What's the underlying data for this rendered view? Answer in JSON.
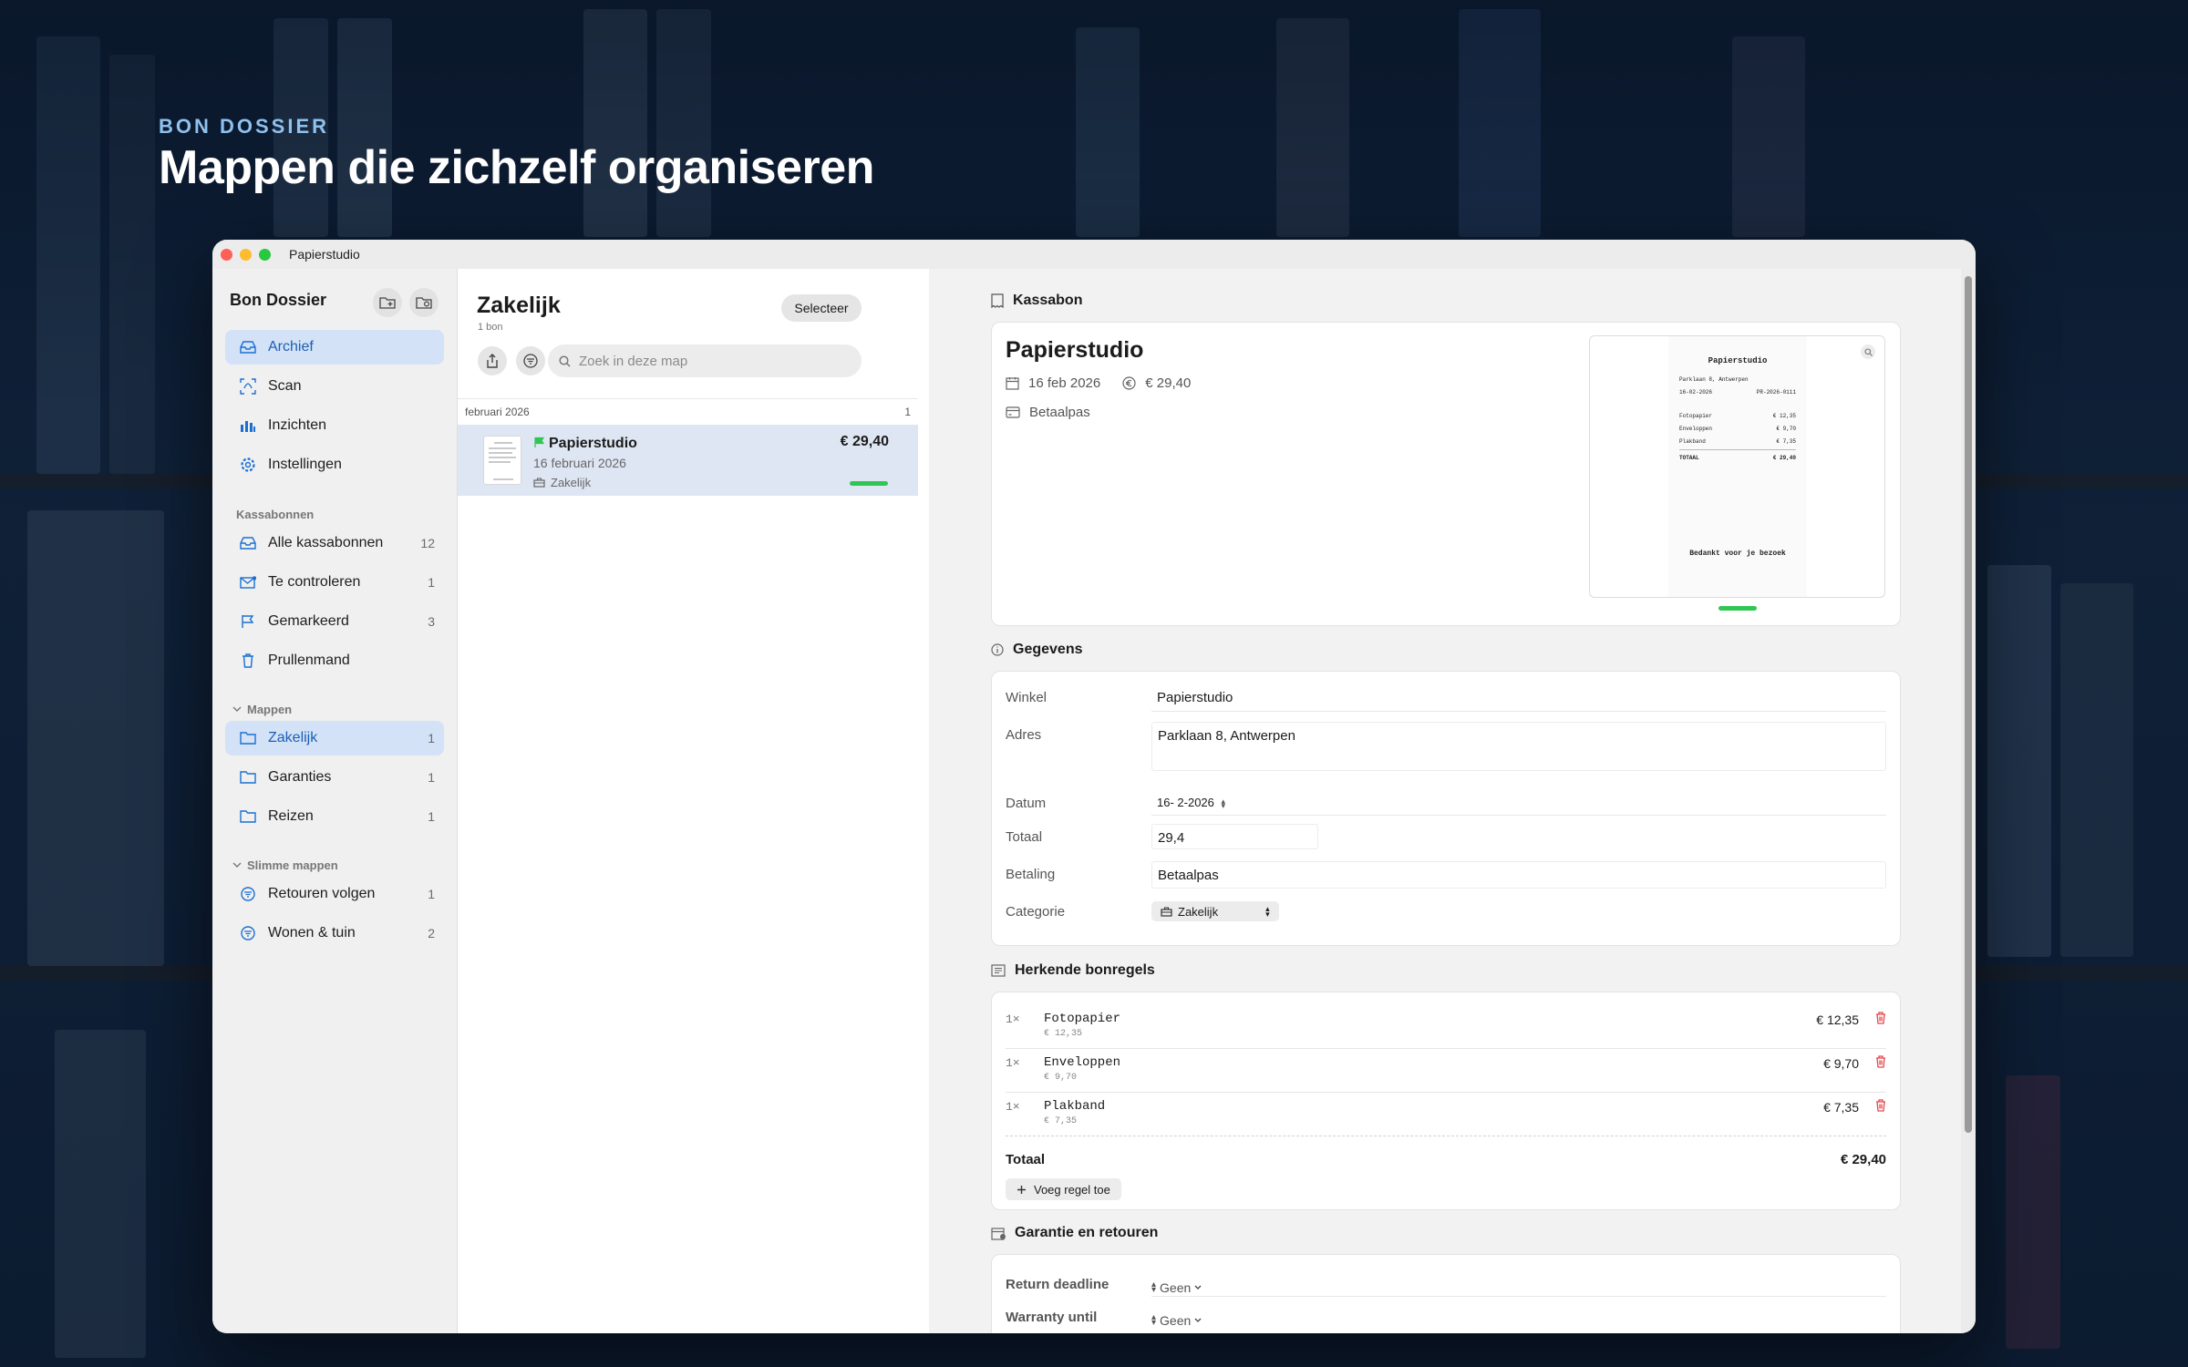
{
  "hero": {
    "kicker": "BON DOSSIER",
    "title": "Mappen die zichzelf organiseren"
  },
  "window": {
    "title": "Papierstudio"
  },
  "sidebar": {
    "app_title": "Bon Dossier",
    "main_items": [
      {
        "label": "Archief",
        "icon": "tray-icon"
      },
      {
        "label": "Scan",
        "icon": "scan-icon"
      },
      {
        "label": "Inzichten",
        "icon": "chart-icon"
      },
      {
        "label": "Instellingen",
        "icon": "gear-icon"
      }
    ],
    "receipts_section": "Kassabonnen",
    "receipt_items": [
      {
        "label": "Alle kassabonnen",
        "count": "12"
      },
      {
        "label": "Te controleren",
        "count": "1"
      },
      {
        "label": "Gemarkeerd",
        "count": "3"
      },
      {
        "label": "Prullenmand",
        "count": ""
      }
    ],
    "folders_section": "Mappen",
    "folder_items": [
      {
        "label": "Zakelijk",
        "count": "1"
      },
      {
        "label": "Garanties",
        "count": "1"
      },
      {
        "label": "Reizen",
        "count": "1"
      }
    ],
    "smart_section": "Slimme mappen",
    "smart_items": [
      {
        "label": "Retouren volgen",
        "count": "1"
      },
      {
        "label": "Wonen & tuin",
        "count": "2"
      }
    ]
  },
  "list": {
    "title": "Zakelijk",
    "subtitle": "1 bon",
    "select_label": "Selecteer",
    "search_placeholder": "Zoek in deze map",
    "group_label": "februari 2026",
    "group_count": "1",
    "row": {
      "name": "Papierstudio",
      "date": "16 februari 2026",
      "category": "Zakelijk",
      "amount": "€ 29,40",
      "flag_color": "#2fc653"
    }
  },
  "detail": {
    "receipt_section": "Kassabon",
    "store": "Papierstudio",
    "date": "16 feb 2026",
    "amount": "€ 29,40",
    "payment": "Betaalpas",
    "preview": {
      "title": "Papierstudio",
      "address": "Parklaan 8, Antwerpen",
      "date": "16-02-2026",
      "ref": "PR-2026-0111",
      "lines": [
        {
          "name": "Fotopapier",
          "amount": "€ 12,35"
        },
        {
          "name": "Enveloppen",
          "amount": "€ 9,70"
        },
        {
          "name": "Plakband",
          "amount": "€ 7,35"
        }
      ],
      "total_label": "TOTAAL",
      "total": "€ 29,40",
      "thanks": "Bedankt voor je bezoek"
    },
    "details_section": "Gegevens",
    "fields": {
      "store_label": "Winkel",
      "store_value": "Papierstudio",
      "address_label": "Adres",
      "address_value": "Parklaan 8, Antwerpen",
      "date_label": "Datum",
      "date_value": "16- 2-2026",
      "total_label": "Totaal",
      "total_value": "29,4",
      "payment_label": "Betaling",
      "payment_value": "Betaalpas",
      "category_label": "Categorie",
      "category_value": "Zakelijk"
    },
    "lines_section": "Herkende bonregels",
    "lines": [
      {
        "qty": "1×",
        "name": "Fotopapier",
        "unit": "€ 12,35",
        "amount": "€ 12,35"
      },
      {
        "qty": "1×",
        "name": "Enveloppen",
        "unit": "€ 9,70",
        "amount": "€ 9,70"
      },
      {
        "qty": "1×",
        "name": "Plakband",
        "unit": "€ 7,35",
        "amount": "€ 7,35"
      }
    ],
    "lines_total_label": "Totaal",
    "lines_total": "€ 29,40",
    "add_line_label": "Voeg regel toe",
    "warranty_section": "Garantie en retouren",
    "return_label": "Return deadline",
    "return_value": "Geen",
    "warranty_label": "Warranty until",
    "warranty_value": "Geen"
  },
  "colors": {
    "accent": "#1b6fd1",
    "active_bg": "#d3e2f7",
    "success": "#2fc653",
    "danger": "#e5484d"
  }
}
